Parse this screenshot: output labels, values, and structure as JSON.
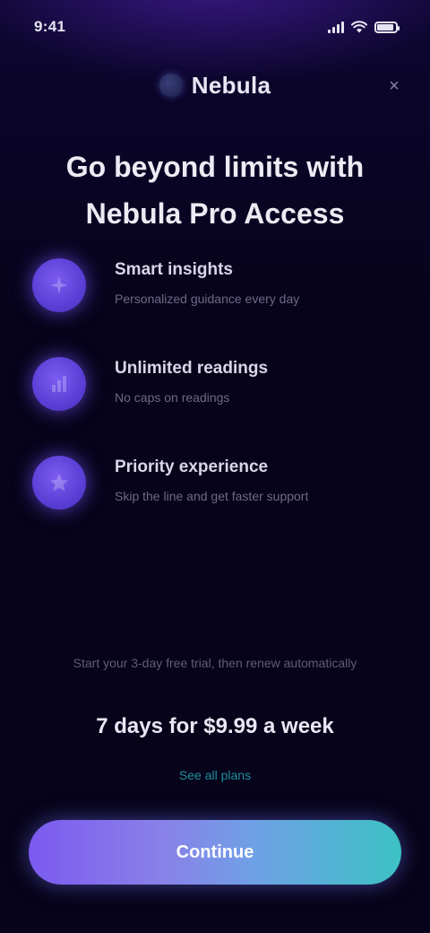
{
  "status_bar": {
    "time": "9:41",
    "signal_icon": "cellular-signal-icon",
    "wifi_icon": "wifi-icon",
    "battery_icon": "battery-icon",
    "battery_level": 0.9
  },
  "header": {
    "brand_name": "Nebula",
    "logo_icon": "planet-logo-icon",
    "close_label": "×"
  },
  "title": "Go beyond limits with Nebula Pro Access",
  "features": [
    {
      "icon": "sparkle-icon",
      "title": "Smart insights",
      "desc": "Personalized guidance every day"
    },
    {
      "icon": "chart-icon",
      "title": "Unlimited readings",
      "desc": "No caps on readings"
    },
    {
      "icon": "star-icon",
      "title": "Priority experience",
      "desc": "Skip the line and get faster support"
    }
  ],
  "pricing": {
    "trial_note": "Start your 3-day free trial, then renew automatically",
    "price": "7 days for $9.99 a week",
    "plans_link": "See all plans"
  },
  "cta": {
    "label": "Continue"
  },
  "colors": {
    "background": "#07031a",
    "accent_purple": "#7b5af0",
    "accent_teal": "#3cc2c4",
    "link": "#1f8f9e"
  }
}
